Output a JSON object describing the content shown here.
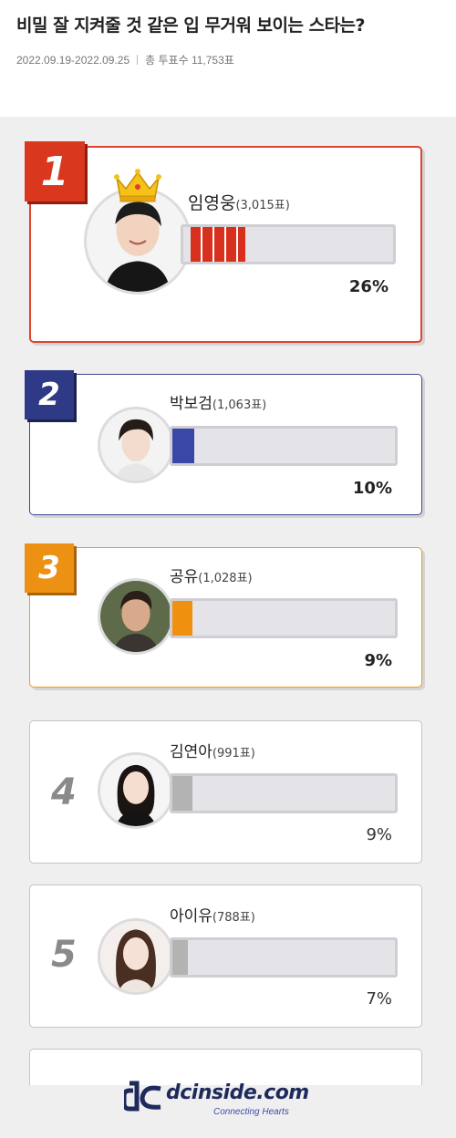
{
  "header": {
    "title": "비밀 잘 지켜줄 것 같은 입 무거워 보이는 스타는?",
    "period": "2022.09.19-2022.09.25",
    "total_votes_label": "총 투표수 11,753표"
  },
  "ranking": [
    {
      "rank": "1",
      "name": "임영웅",
      "votes": "(3,015표)",
      "percent": "26%",
      "share": 0.26,
      "accent": "#d9381e"
    },
    {
      "rank": "2",
      "name": "박보검",
      "votes": "(1,063표)",
      "percent": "10%",
      "share": 0.1,
      "accent": "#2e3a86"
    },
    {
      "rank": "3",
      "name": "공유",
      "votes": "(1,028표)",
      "percent": "9%",
      "share": 0.09,
      "accent": "#ec9114"
    },
    {
      "rank": "4",
      "name": "김연아",
      "votes": "(991표)",
      "percent": "9%",
      "share": 0.09,
      "accent": "#b3b3b3"
    },
    {
      "rank": "5",
      "name": "아이유",
      "votes": "(788표)",
      "percent": "7%",
      "share": 0.07,
      "accent": "#b3b3b3"
    }
  ],
  "footer": {
    "brand": "dcinside.com",
    "tagline": "Connecting Hearts"
  }
}
